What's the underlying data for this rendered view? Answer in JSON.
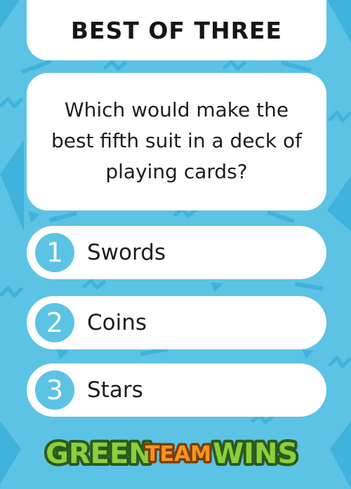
{
  "title": "BEST OF THREE",
  "question": "Which would make the best fifth suit in a deck of playing cards?",
  "answers": [
    {
      "number": "1",
      "label": "Swords"
    },
    {
      "number": "2",
      "label": "Coins"
    },
    {
      "number": "3",
      "label": "Stars"
    }
  ],
  "logo": {
    "word1": "GREEN",
    "word2": "TEAM",
    "word3": "WINS"
  },
  "colors": {
    "background": "#5cc3e4",
    "accent": "#3aaed6",
    "card": "#ffffff",
    "logo_green": "#8ccf3b",
    "logo_orange": "#f7941d"
  }
}
